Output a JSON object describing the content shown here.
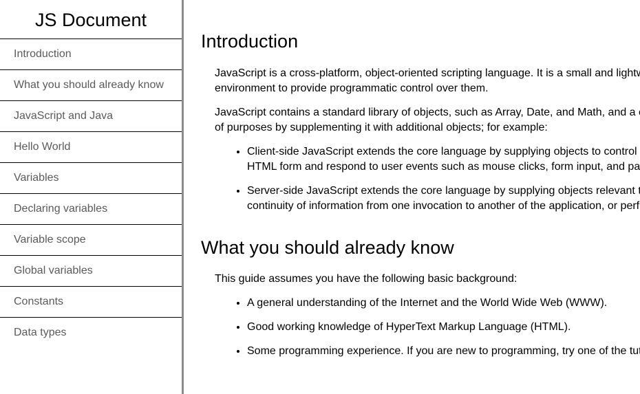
{
  "sidebar": {
    "title": "JS Document",
    "items": [
      {
        "label": "Introduction"
      },
      {
        "label": "What you should already know"
      },
      {
        "label": "JavaScript and Java"
      },
      {
        "label": "Hello World"
      },
      {
        "label": "Variables"
      },
      {
        "label": "Declaring variables"
      },
      {
        "label": "Variable scope"
      },
      {
        "label": "Global variables"
      },
      {
        "label": "Constants"
      },
      {
        "label": "Data types"
      }
    ]
  },
  "main": {
    "introduction": {
      "heading": "Introduction",
      "p1_line1": "JavaScript is a cross-platform, object-oriented scripting language. It is a small and lightw",
      "p1_line2": "environment to provide programmatic control over them.",
      "p2_line1": "JavaScript contains a standard library of objects, such as Array, Date, and Math, and a c",
      "p2_line2": "of purposes by supplementing it with additional objects; for example:",
      "bullets": [
        {
          "line1": "Client-side JavaScript extends the core language by supplying objects to control",
          "line2": "HTML form and respond to user events such as mouse clicks, form input, and pa"
        },
        {
          "line1": "Server-side JavaScript extends the core language by supplying objects relevant t",
          "line2": "continuity of information from one invocation to another of the application, or perf"
        }
      ]
    },
    "what_you_should_know": {
      "heading": "What you should already know",
      "intro": "This guide assumes you have the following basic background:",
      "bullets": [
        "A general understanding of the Internet and the World Wide Web (WWW).",
        "Good working knowledge of HyperText Markup Language (HTML).",
        "Some programming experience. If you are new to programming, try one of the tut"
      ]
    }
  },
  "colors": {
    "nav_text": "#5a5a5a",
    "sidebar_border": "#8a8a8a",
    "divider": "#000000",
    "background": "#ffffff"
  }
}
